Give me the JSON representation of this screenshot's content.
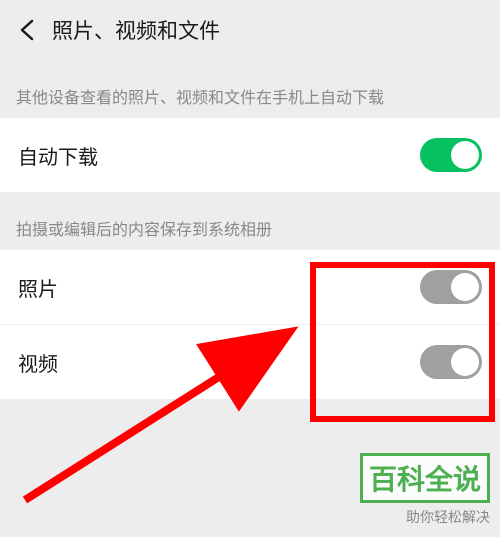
{
  "header": {
    "title": "照片、视频和文件"
  },
  "sections": {
    "autoDownload": {
      "desc": "其他设备查看的照片、视频和文件在手机上自动下载",
      "row": {
        "label": "自动下载",
        "on": true
      }
    },
    "saveToAlbum": {
      "desc": "拍摄或编辑后的内容保存到系统相册",
      "rows": [
        {
          "label": "照片",
          "on": false
        },
        {
          "label": "视频",
          "on": false
        }
      ]
    }
  },
  "watermark": {
    "main": "百科全说",
    "sub": "助你轻松解决"
  },
  "annotation": {
    "highlightColor": "#ff0000"
  }
}
